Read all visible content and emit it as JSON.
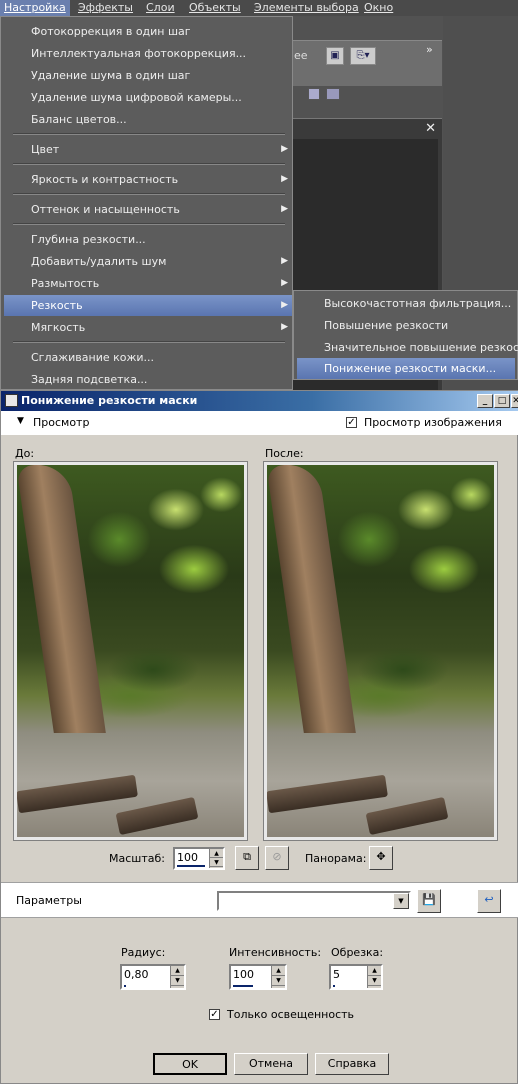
{
  "menubar": {
    "items": [
      "Настройка",
      "Эффекты",
      "Слои",
      "Объекты",
      "Элементы выбора",
      "Окно"
    ]
  },
  "toolbar_text": "ее",
  "menu": {
    "items": [
      "Фотокоррекция в один шаг",
      "Интеллектуальная фотокоррекция...",
      "Удаление шума в один шаг",
      "Удаление шума цифровой камеры...",
      "Баланс цветов...",
      "Цвет",
      "Яркость и контрастность",
      "Оттенок и насыщенность",
      "Глубина резкости...",
      "Добавить/удалить шум",
      "Размытость",
      "Резкость",
      "Мягкость",
      "Сглаживание кожи...",
      "Задняя подсветка..."
    ],
    "submenu_arrow": "▶"
  },
  "submenu": {
    "items": [
      "Высокочастотная фильтрация...",
      "Повышение резкости",
      "Значительное повышение резкости",
      "Понижение резкости маски..."
    ]
  },
  "dialog": {
    "title": "Понижение резкости маски",
    "preview_toggle": "Просмотр",
    "preview_image_label": "Просмотр изображения",
    "preview_image_checked": true,
    "before_label": "До:",
    "after_label": "После:",
    "zoom_label": "Масштаб:",
    "zoom_value": "100",
    "pan_label": "Панорама:",
    "params_label": "Параметры",
    "preset_value": "",
    "radius_label": "Радиус:",
    "radius_value": "0,80",
    "intensity_label": "Интенсивность:",
    "intensity_value": "100",
    "clip_label": "Обрезка:",
    "clip_value": "5",
    "luminance_label": "Только освещенность",
    "luminance_checked": true,
    "ok_label": "OK",
    "cancel_label": "Отмена",
    "help_label": "Справка"
  },
  "colors": {
    "menu_bg": "#5c5c5c",
    "menu_highlight": "#6a84bc",
    "title_bar": "#0a246a",
    "dialog_bg": "#d4d0c8"
  }
}
